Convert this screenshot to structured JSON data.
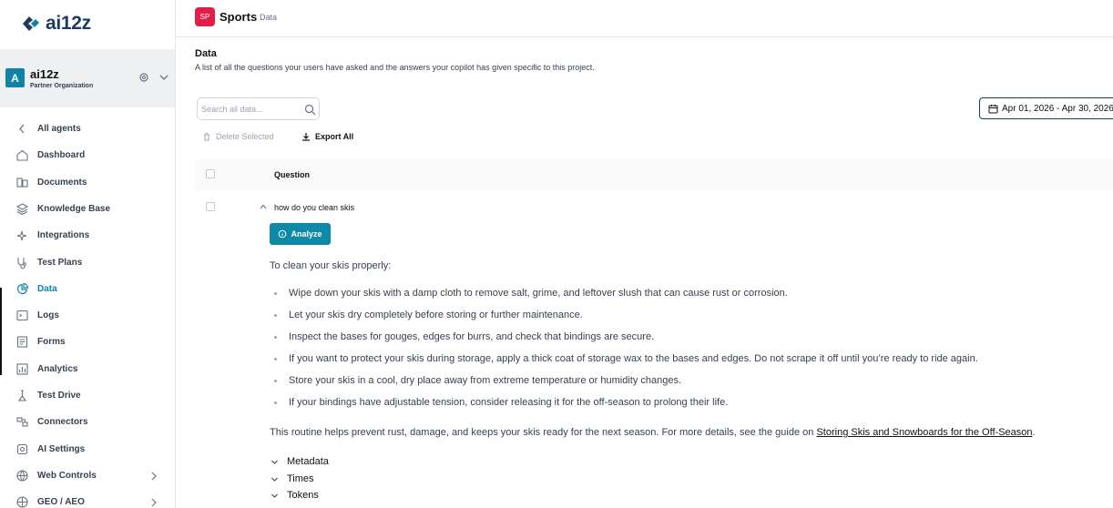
{
  "brand": {
    "name": "ai12z"
  },
  "org": {
    "initial": "A",
    "name": "ai12z",
    "subtitle": "Partner Organization"
  },
  "nav": [
    {
      "label": "All agents",
      "icon": "chevron-left-icon"
    },
    {
      "label": "Dashboard",
      "icon": "home-icon"
    },
    {
      "label": "Documents",
      "icon": "documents-icon"
    },
    {
      "label": "Knowledge Base",
      "icon": "layers-icon"
    },
    {
      "label": "Integrations",
      "icon": "sparkles-icon"
    },
    {
      "label": "Test Plans",
      "icon": "stethoscope-icon"
    },
    {
      "label": "Data",
      "icon": "pie-chart-icon",
      "active": true
    },
    {
      "label": "Logs",
      "icon": "terminal-icon"
    },
    {
      "label": "Forms",
      "icon": "form-icon"
    },
    {
      "label": "Analytics",
      "icon": "analytics-icon"
    },
    {
      "label": "Test Drive",
      "icon": "test-drive-icon"
    },
    {
      "label": "Connectors",
      "icon": "connectors-icon"
    },
    {
      "label": "AI Settings",
      "icon": "ai-settings-icon"
    },
    {
      "label": "Web Controls",
      "icon": "globe-icon",
      "expandable": true
    },
    {
      "label": "GEO / AEO",
      "icon": "geo-icon",
      "expandable": true
    }
  ],
  "project": {
    "badge": "SP",
    "name": "Sports",
    "crumb": "Data"
  },
  "page": {
    "title": "Data",
    "description": "A list of all the questions your users have asked and the answers your copilot has given specific to this project."
  },
  "search": {
    "placeholder": "Search all data..."
  },
  "date_range": "Apr 01, 2026 - Apr 30, 2026",
  "toolbar": {
    "delete_label": "Delete Selected",
    "export_label": "Export All"
  },
  "table": {
    "header_question": "Question",
    "row": {
      "question": "how do you clean skis",
      "analyze_label": "Analyze",
      "answer_intro": "To clean your skis properly:",
      "bullets": [
        "Wipe down your skis with a damp cloth to remove salt, grime, and leftover slush that can cause rust or corrosion.",
        "Let your skis dry completely before storing or further maintenance.",
        "Inspect the bases for gouges, edges for burrs, and check that bindings are secure.",
        "If you want to protect your skis during storage, apply a thick coat of storage wax to the bases and edges. Do not scrape it off until you’re ready to ride again.",
        "Store your skis in a cool, dry place away from extreme temperature or humidity changes.",
        "If your bindings have adjustable tension, consider releasing it for the off-season to prolong their life."
      ],
      "outro_prefix": "This routine helps prevent rust, damage, and keeps your skis ready for the next season. For more details, see the guide on ",
      "outro_link": "Storing Skis and Snowboards for the Off-Season",
      "outro_suffix": ".",
      "sections": [
        "Metadata",
        "Times",
        "Tokens"
      ]
    }
  },
  "colors": {
    "accent": "#0e85a6",
    "project_badge": "#e11d48",
    "brand_dark": "#1e3a5f"
  }
}
